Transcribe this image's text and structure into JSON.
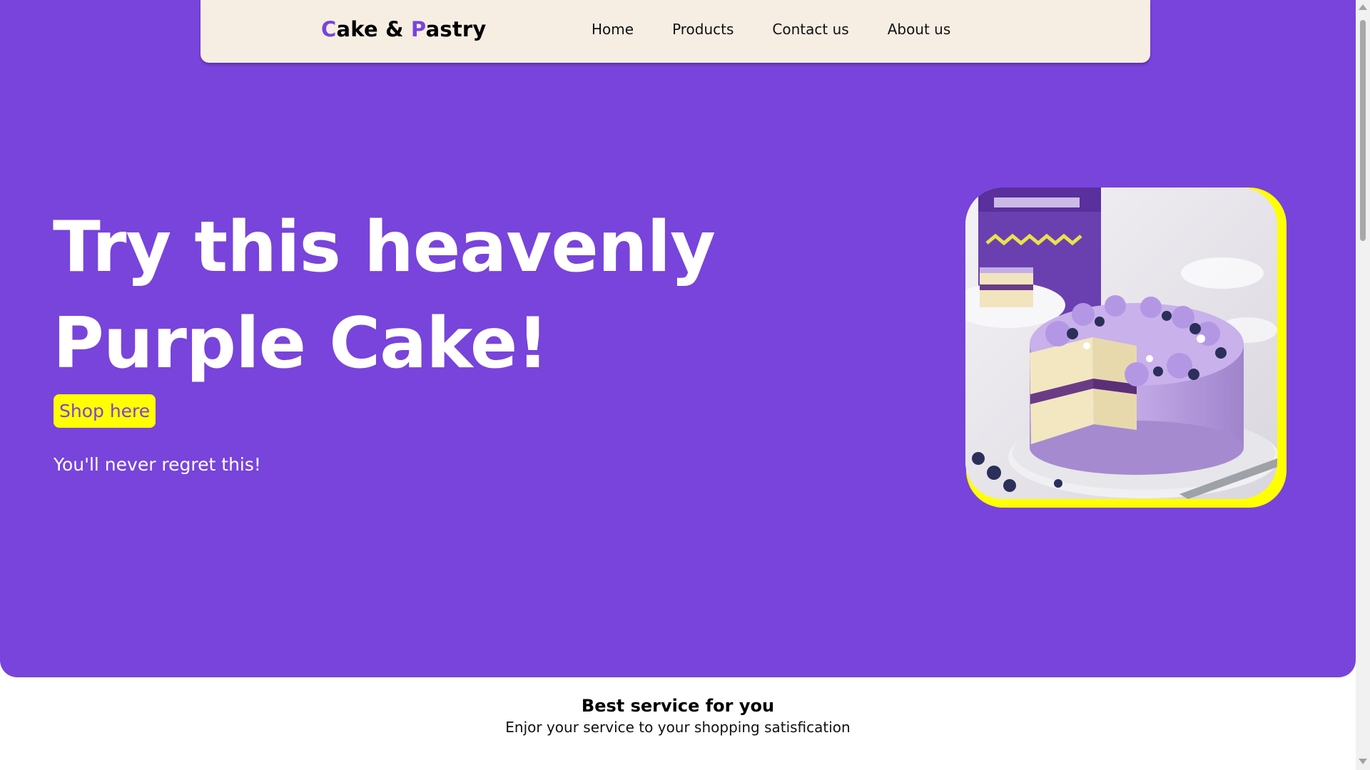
{
  "brand": {
    "logo_first_initial": "C",
    "logo_first_rest": "ake & ",
    "logo_second_initial": "P",
    "logo_second_rest": "astry"
  },
  "nav": {
    "items": [
      {
        "label": "Home"
      },
      {
        "label": "Products"
      },
      {
        "label": "Contact us"
      },
      {
        "label": "About us"
      }
    ]
  },
  "hero": {
    "headline_line1": "Try this heavenly",
    "headline_line2": "Purple Cake!",
    "cta_label": "Shop here",
    "tagline": "You'll never regret this!",
    "image_icon": "cake-photo"
  },
  "service": {
    "title": "Best service for you",
    "subtitle": "Enjor your service to your shopping satisfication"
  },
  "colors": {
    "hero_background": "#7844db",
    "navbar_background": "#f6ede3",
    "accent_yellow": "#ffff00",
    "logo_accent": "#7844db"
  }
}
